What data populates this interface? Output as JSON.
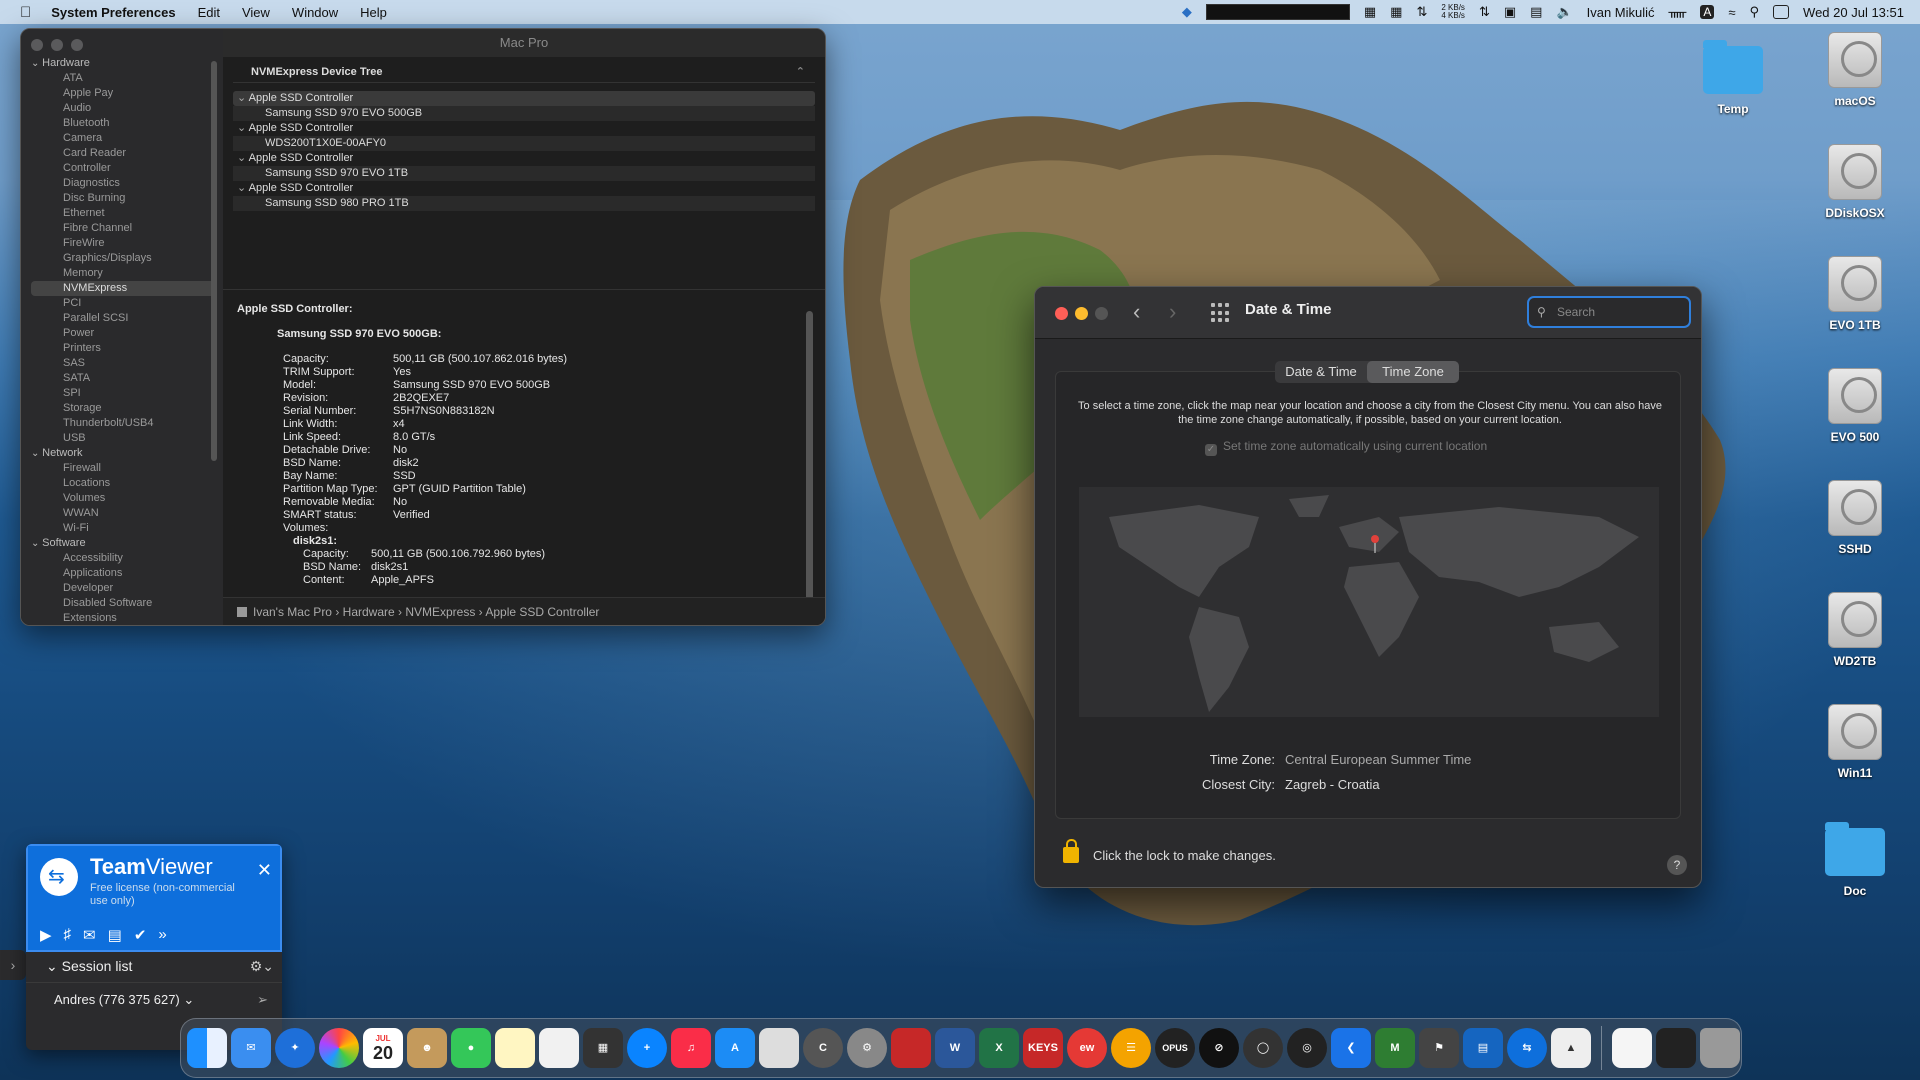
{
  "menubar": {
    "app": "System Preferences",
    "menus": [
      "Edit",
      "View",
      "Window",
      "Help"
    ],
    "net_up": "2 KB/s",
    "net_down": "4 KB/s",
    "user": "Ivan Mikulić",
    "clock": "Wed 20 Jul  13:51"
  },
  "sysinfo": {
    "window_title": "Mac Pro",
    "sidebar": [
      {
        "label": "Hardware",
        "group": true
      },
      {
        "label": "ATA"
      },
      {
        "label": "Apple Pay"
      },
      {
        "label": "Audio"
      },
      {
        "label": "Bluetooth"
      },
      {
        "label": "Camera"
      },
      {
        "label": "Card Reader"
      },
      {
        "label": "Controller"
      },
      {
        "label": "Diagnostics"
      },
      {
        "label": "Disc Burning"
      },
      {
        "label": "Ethernet"
      },
      {
        "label": "Fibre Channel"
      },
      {
        "label": "FireWire"
      },
      {
        "label": "Graphics/Displays"
      },
      {
        "label": "Memory"
      },
      {
        "label": "NVMExpress",
        "selected": true
      },
      {
        "label": "PCI"
      },
      {
        "label": "Parallel SCSI"
      },
      {
        "label": "Power"
      },
      {
        "label": "Printers"
      },
      {
        "label": "SAS"
      },
      {
        "label": "SATA"
      },
      {
        "label": "SPI"
      },
      {
        "label": "Storage"
      },
      {
        "label": "Thunderbolt/USB4"
      },
      {
        "label": "USB"
      },
      {
        "label": "Network",
        "group": true
      },
      {
        "label": "Firewall"
      },
      {
        "label": "Locations"
      },
      {
        "label": "Volumes"
      },
      {
        "label": "WWAN"
      },
      {
        "label": "Wi-Fi"
      },
      {
        "label": "Software",
        "group": true
      },
      {
        "label": "Accessibility"
      },
      {
        "label": "Applications"
      },
      {
        "label": "Developer"
      },
      {
        "label": "Disabled Software"
      },
      {
        "label": "Extensions"
      }
    ],
    "tree_header": "NVMExpress Device Tree",
    "tree_rows": [
      {
        "label": "Apple SSD Controller",
        "kind": "ctrl",
        "selected": true
      },
      {
        "label": "Samsung SSD 970 EVO 500GB",
        "kind": "dev"
      },
      {
        "label": "Apple SSD Controller",
        "kind": "ctrl"
      },
      {
        "label": "WDS200T1X0E-00AFY0",
        "kind": "dev"
      },
      {
        "label": "Apple SSD Controller",
        "kind": "ctrl"
      },
      {
        "label": "Samsung SSD 970 EVO 1TB",
        "kind": "dev"
      },
      {
        "label": "Apple SSD Controller",
        "kind": "ctrl"
      },
      {
        "label": "Samsung SSD 980 PRO 1TB",
        "kind": "dev"
      }
    ],
    "detail_heading": "Apple SSD Controller:",
    "detail_device": "Samsung SSD 970 EVO 500GB:",
    "props": [
      {
        "k": "Capacity:",
        "v": "500,11 GB (500.107.862.016 bytes)"
      },
      {
        "k": "TRIM Support:",
        "v": "Yes"
      },
      {
        "k": "Model:",
        "v": "Samsung SSD 970 EVO 500GB"
      },
      {
        "k": "Revision:",
        "v": "2B2QEXE7"
      },
      {
        "k": "Serial Number:",
        "v": "S5H7NS0N883182N"
      },
      {
        "k": "Link Width:",
        "v": "x4"
      },
      {
        "k": "Link Speed:",
        "v": "8.0 GT/s"
      },
      {
        "k": "Detachable Drive:",
        "v": "No"
      },
      {
        "k": "BSD Name:",
        "v": "disk2"
      },
      {
        "k": "Bay Name:",
        "v": "SSD"
      },
      {
        "k": "Partition Map Type:",
        "v": "GPT (GUID Partition Table)"
      },
      {
        "k": "Removable Media:",
        "v": "No"
      },
      {
        "k": "SMART status:",
        "v": "Verified"
      },
      {
        "k": "Volumes:",
        "v": ""
      }
    ],
    "volume_name": "disk2s1:",
    "volume_props": [
      {
        "k": "Capacity:",
        "v": "500,11 GB (500.106.792.960 bytes)"
      },
      {
        "k": "BSD Name:",
        "v": "disk2s1"
      },
      {
        "k": "Content:",
        "v": "Apple_APFS"
      }
    ],
    "path": "Ivan's Mac Pro › Hardware › NVMExpress › Apple SSD Controller"
  },
  "datetime": {
    "title": "Date & Time",
    "search_placeholder": "Search",
    "tabs": [
      "Date & Time",
      "Time Zone"
    ],
    "active_tab": 1,
    "description": "To select a time zone, click the map near your location and choose a city from the Closest City menu. You can also have the time zone change automatically, if possible, based on your current location.",
    "auto_label": "Set time zone automatically using current location",
    "tz_label": "Time Zone:",
    "tz_value": "Central European Summer Time",
    "city_label": "Closest City:",
    "city_value": "Zagreb - Croatia",
    "lock_text": "Click the lock to make changes.",
    "help": "?"
  },
  "desktop": [
    {
      "label": "Temp",
      "type": "folder"
    },
    {
      "label": "macOS",
      "type": "disk"
    },
    {
      "label": "DDiskOSX",
      "type": "disk"
    },
    {
      "label": "EVO 1TB",
      "type": "disk"
    },
    {
      "label": "EVO 500",
      "type": "disk"
    },
    {
      "label": "SSHD",
      "type": "disk"
    },
    {
      "label": "WD2TB",
      "type": "disk"
    },
    {
      "label": "Win11",
      "type": "disk"
    },
    {
      "label": "Doc",
      "type": "folder"
    }
  ],
  "teamviewer": {
    "brand_a": "Team",
    "brand_b": "Viewer",
    "license": "Free license (non-commercial use only)",
    "session_list": "Session list",
    "user": "Andres (776 375 627)"
  },
  "dock": {
    "calendar_month": "JUL",
    "calendar_day": "20",
    "keys_label": "KEYS",
    "opus_label": "OPUS"
  },
  "colors": {
    "accent": "#2f7fdc",
    "teamviewer": "#0e6fdc",
    "lock": "#f0b400"
  }
}
